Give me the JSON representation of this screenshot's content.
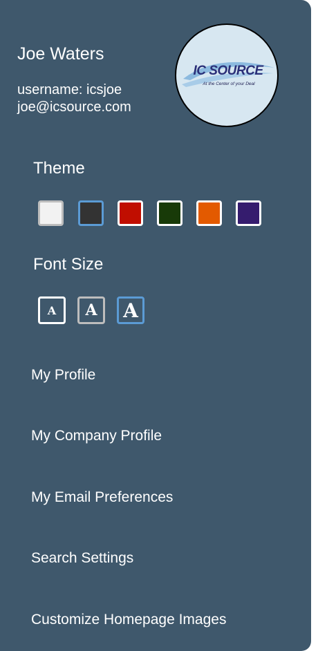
{
  "user": {
    "name": "Joe Waters",
    "username": "username: icsjoe",
    "email": "joe@icsource.com"
  },
  "logo": {
    "brand": "IC SOURCE",
    "tagline": "At the Center of your Deal"
  },
  "theme": {
    "title": "Theme",
    "swatches": [
      {
        "color": "#f2f2f2",
        "border": "#bdbdbd",
        "selected": false
      },
      {
        "color": "#333333",
        "border": "#5b9bd5",
        "selected": true
      },
      {
        "color": "#c00e00",
        "border": "#ffffff",
        "selected": false
      },
      {
        "color": "#183a08",
        "border": "#ffffff",
        "selected": false
      },
      {
        "color": "#e35a00",
        "border": "#ffffff",
        "selected": false
      },
      {
        "color": "#351c6e",
        "border": "#ffffff",
        "selected": false
      }
    ]
  },
  "font_size": {
    "title": "Font Size",
    "options": [
      {
        "label": "A",
        "size": "small",
        "border": "#ffffff"
      },
      {
        "label": "A",
        "size": "medium",
        "border": "#bdbdbd"
      },
      {
        "label": "A",
        "size": "large",
        "border": "#5b9bd5",
        "selected": true
      }
    ]
  },
  "menu": {
    "items": [
      {
        "label": "My Profile"
      },
      {
        "label": "My Company Profile"
      },
      {
        "label": "My Email Preferences"
      },
      {
        "label": "Search Settings"
      },
      {
        "label": "Customize Homepage Images"
      }
    ]
  }
}
